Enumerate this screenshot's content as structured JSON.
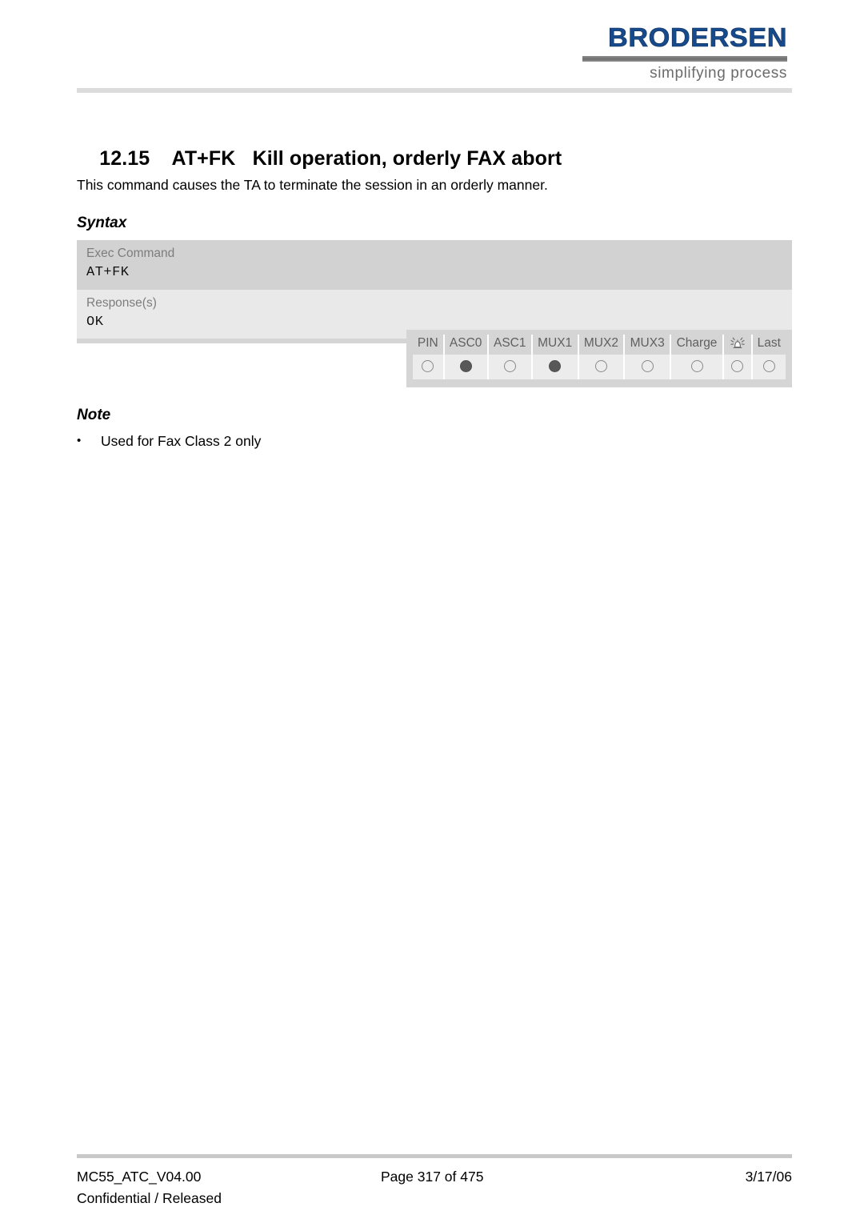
{
  "brand": {
    "wordmark": "BRODERSEN",
    "tagline": "simplifying process",
    "wordmark_color": "#174a8b",
    "rule_color": "#6e6e6e"
  },
  "heading": {
    "number": "12.15",
    "command": "AT+FK",
    "title": "Kill operation, orderly FAX abort",
    "full": "12.15    AT+FK   Kill operation, orderly FAX abort"
  },
  "intro": "This command causes the TA to terminate the session in an orderly manner.",
  "subheads": {
    "syntax": "Syntax",
    "note": "Note"
  },
  "syntax_table": {
    "rows": [
      {
        "label": "Exec Command",
        "code": "AT+FK"
      },
      {
        "label": "Response(s)",
        "code": "OK"
      }
    ],
    "exec_bg": "#d2d2d2",
    "resp_bg": "#e9e9e9"
  },
  "indicator_table": {
    "columns": [
      {
        "label": "PIN",
        "icon": null,
        "state": "off"
      },
      {
        "label": "ASC0",
        "icon": null,
        "state": "on"
      },
      {
        "label": "ASC1",
        "icon": null,
        "state": "off"
      },
      {
        "label": "MUX1",
        "icon": null,
        "state": "on"
      },
      {
        "label": "MUX2",
        "icon": null,
        "state": "off"
      },
      {
        "label": "MUX3",
        "icon": null,
        "state": "off"
      },
      {
        "label": "Charge",
        "icon": null,
        "state": "off"
      },
      {
        "label": "",
        "icon": "alarm-icon",
        "state": "off"
      },
      {
        "label": "Last",
        "icon": null,
        "state": "off"
      }
    ],
    "header_bg": "#d5d5d5",
    "cell_bg": "#ececec",
    "dot_on_color": "#585858",
    "dot_off_color": "#8a8a8a"
  },
  "note": {
    "bullet": "•",
    "items": [
      "Used for Fax Class 2 only"
    ]
  },
  "footer": {
    "document_id": "MC55_ATC_V04.00",
    "classification": "Confidential / Released",
    "page": "Page 317 of 475",
    "date": "3/17/06"
  }
}
